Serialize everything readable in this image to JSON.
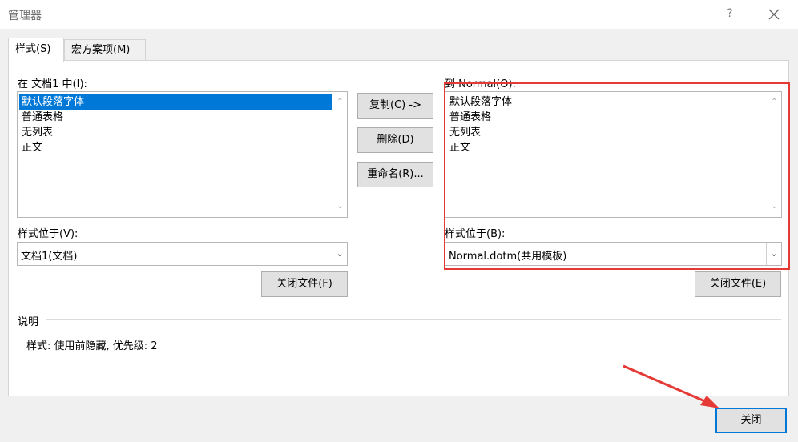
{
  "window": {
    "title": "管理器",
    "help_label": "?"
  },
  "tabs": [
    {
      "label": "样式(S)",
      "active": true
    },
    {
      "label": "宏方案项(M)",
      "active": false
    }
  ],
  "left": {
    "list_label": "在 文档1 中(I):",
    "items": [
      "默认段落字体",
      "普通表格",
      "无列表",
      "正文"
    ],
    "selected_index": 0,
    "location_label": "样式位于(V):",
    "location_value": "文档1(文档)",
    "close_file_label": "关闭文件(F)"
  },
  "right": {
    "list_label": "到 Normal(O):",
    "items": [
      "默认段落字体",
      "普通表格",
      "无列表",
      "正文"
    ],
    "location_label": "样式位于(B):",
    "location_value": "Normal.dotm(共用模板)",
    "close_file_label": "关闭文件(E)"
  },
  "middle_buttons": {
    "copy": "复制(C) ->",
    "delete": "删除(D)",
    "rename": "重命名(R)..."
  },
  "description": {
    "heading": "说明",
    "text": "样式: 使用前隐藏, 优先级: 2"
  },
  "footer": {
    "close_label": "关闭"
  },
  "colors": {
    "selection": "#0078d7",
    "annotation": "#e53935"
  }
}
